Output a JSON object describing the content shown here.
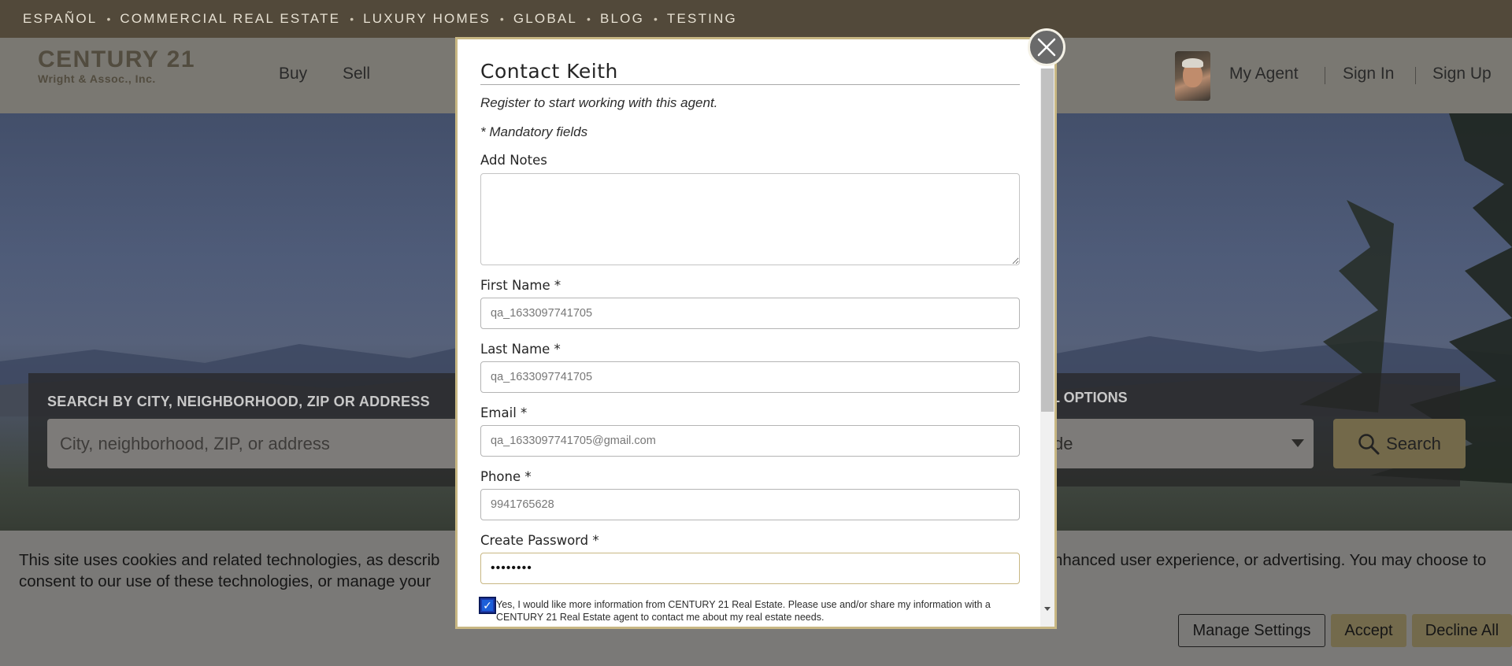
{
  "topbar": {
    "items": [
      "ESPAÑOL",
      "COMMERCIAL REAL ESTATE",
      "LUXURY HOMES",
      "GLOBAL",
      "BLOG",
      "TESTING"
    ],
    "separator": "•"
  },
  "header": {
    "logo_main": "CENTURY 21",
    "logo_sub": "Wright & Assoc., Inc.",
    "nav": [
      "Buy",
      "Sell"
    ],
    "my_agent": "My Agent",
    "sign_in": "Sign In",
    "sign_up": "Sign Up"
  },
  "search": {
    "label": "SEARCH BY CITY, NEIGHBORHOOD, ZIP OR ADDRESS",
    "placeholder": "City, neighborhood, ZIP, or address",
    "options_label": "AL OPTIONS",
    "options_value": "de",
    "button_label": "Search"
  },
  "cookie": {
    "text_left_1": "This site uses cookies and related technologies, as describ",
    "text_right_1": "nhanced user experience, or advertising. You may choose to",
    "text_left_2": "consent to our use of these technologies, or manage your",
    "manage_label": "Manage Settings",
    "accept_label": "Accept",
    "decline_label": "Decline All"
  },
  "modal": {
    "title": "Contact Keith",
    "subtitle": "Register to start working with this agent.",
    "mandatory_note": "* Mandatory fields",
    "notes_label": "Add Notes",
    "first_name_label": "First Name *",
    "first_name_value": "qa_1633097741705",
    "last_name_label": "Last Name *",
    "last_name_value": "qa_1633097741705",
    "email_label": "Email *",
    "email_value": "qa_1633097741705@gmail.com",
    "phone_label": "Phone *",
    "phone_value": "9941765628",
    "password_label": "Create Password *",
    "password_value": "••••••••",
    "consent_text": "Yes, I would like more information from CENTURY 21 Real Estate. Please use and/or share my information with a CENTURY 21 Real Estate agent to contact me about my real estate needs.",
    "consent_checked": true
  },
  "colors": {
    "topbar_bg": "#52493a",
    "brand_gold": "#c8b783",
    "button_gold": "#736a4c",
    "checkbox_blue": "#1c5fd9"
  },
  "icons": {
    "close": "close-icon",
    "search": "search-icon",
    "caret": "chevron-down-icon",
    "check": "check-icon"
  }
}
